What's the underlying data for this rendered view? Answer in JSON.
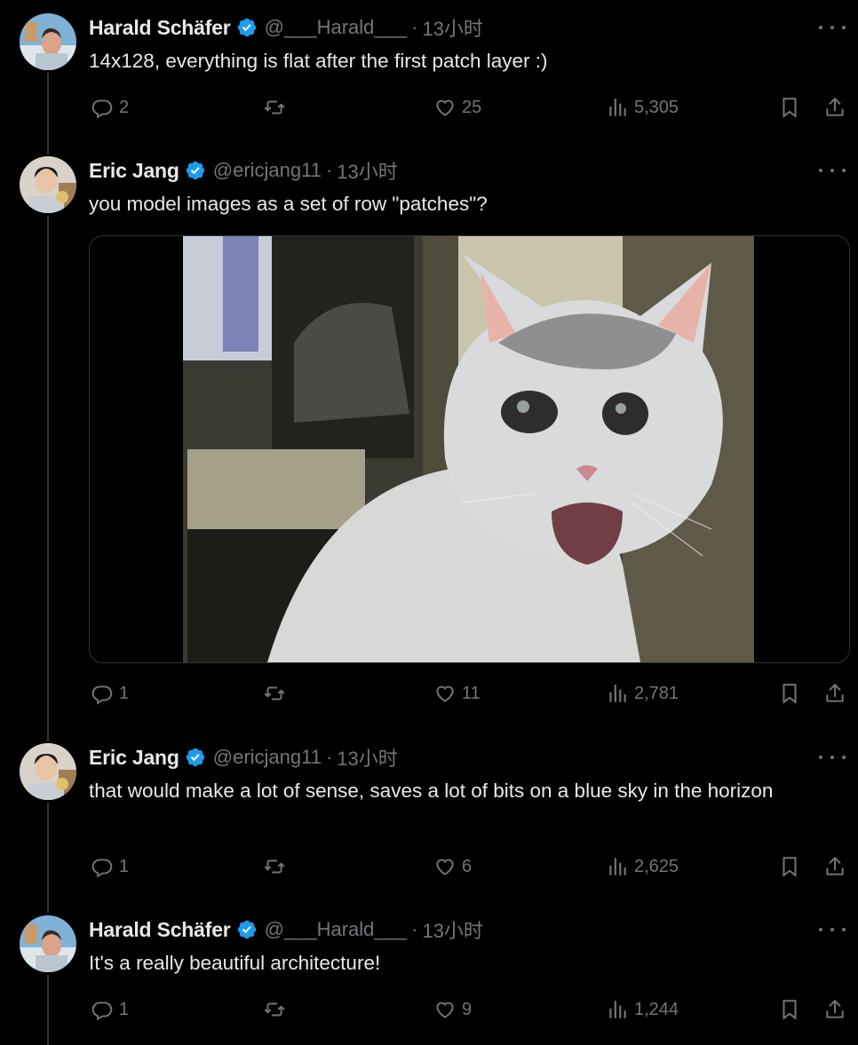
{
  "colors": {
    "background": "#000000",
    "text": "#e7e9ea",
    "muted": "#71767b",
    "verified": "#1d9bf0",
    "divider": "#333639"
  },
  "tweets": [
    {
      "name": "Harald Schäfer",
      "handle": "@___Harald___",
      "dot": "·",
      "time": "13小时",
      "text": "14x128, everything is flat after the first patch layer :)",
      "replies": "2",
      "retweets": "",
      "likes": "25",
      "views": "5,305"
    },
    {
      "name": "Eric Jang",
      "handle": "@ericjang11",
      "dot": "·",
      "time": "13小时",
      "text": "you model images as a set of row \"patches\"?",
      "media": {
        "icon": "surprised-cat-photo"
      },
      "replies": "1",
      "retweets": "",
      "likes": "11",
      "views": "2,781"
    },
    {
      "name": "Eric Jang",
      "handle": "@ericjang11",
      "dot": "·",
      "time": "13小时",
      "text": "that would make a lot of sense, saves a lot of bits on a blue sky in the horizon",
      "replies": "1",
      "retweets": "",
      "likes": "6",
      "views": "2,625"
    },
    {
      "name": "Harald Schäfer",
      "handle": "@___Harald___",
      "dot": "·",
      "time": "13小时",
      "text": "It's a really beautiful architecture!",
      "replies": "1",
      "retweets": "",
      "likes": "9",
      "views": "1,244"
    }
  ]
}
